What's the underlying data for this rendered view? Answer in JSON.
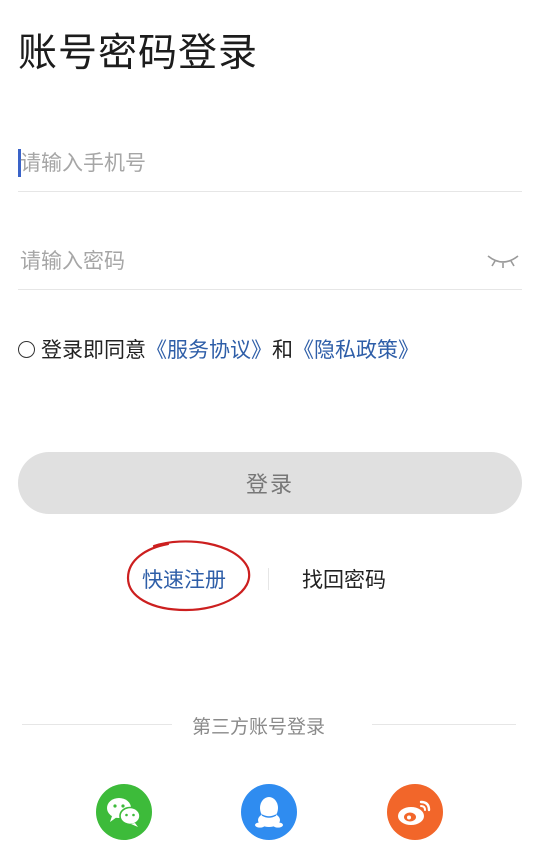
{
  "header": {
    "title": "账号密码登录"
  },
  "form": {
    "phone_placeholder": "请输入手机号",
    "password_placeholder": "请输入密码"
  },
  "agreement": {
    "prefix": "登录即同意",
    "terms_link": "《服务协议》",
    "joiner": "和",
    "privacy_link": "《隐私政策》",
    "checked": false
  },
  "login_button": {
    "label": "登录",
    "state": "disabled"
  },
  "links": {
    "register": "快速注册",
    "find_password": "找回密码"
  },
  "third_party": {
    "label": "第三方账号登录",
    "providers": [
      {
        "name": "wechat",
        "icon": "wechat-icon",
        "color": "#3dbb3a"
      },
      {
        "name": "qq",
        "icon": "qq-icon",
        "color": "#2f8cf0"
      },
      {
        "name": "weibo",
        "icon": "weibo-icon",
        "color": "#f2662a"
      }
    ]
  },
  "colors": {
    "link": "#2e5ea8",
    "caret": "#3a63c8",
    "button_disabled": "#e0e0e0",
    "annotation": "#cc1f1f"
  }
}
